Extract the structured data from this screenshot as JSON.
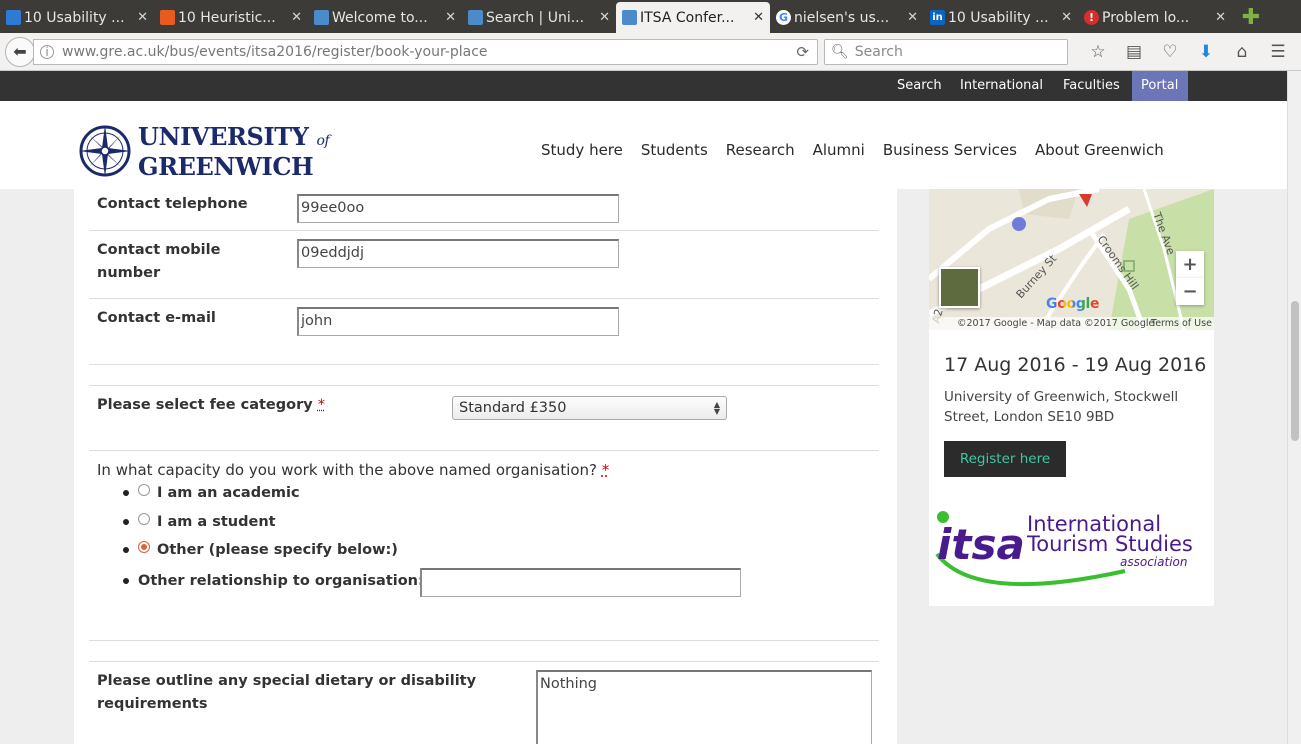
{
  "browser": {
    "tabs": [
      {
        "title": "10 Usability ...",
        "fav_color": "#2f7bd4",
        "active": false
      },
      {
        "title": "10 Heuristic...",
        "fav_color": "#e85b1c",
        "active": false
      },
      {
        "title": "Welcome to...",
        "fav_color": "#4b8bc9",
        "active": false
      },
      {
        "title": "Search | Uni...",
        "fav_color": "#4b8bc9",
        "active": false
      },
      {
        "title": "ITSA Confer...",
        "fav_color": "#4b8bc9",
        "active": true
      },
      {
        "title": "nielsen's us...",
        "fav_color": "#4285f4",
        "active": false
      },
      {
        "title": "10 Usability ...",
        "fav_color": "#0a66c2",
        "active": false
      },
      {
        "title": "Problem lo...",
        "fav_color": "#d32f2f",
        "active": false
      }
    ],
    "url_host": "www.gre.ac.uk",
    "url_path": "/bus/events/itsa2016/register/book-your-place",
    "search_placeholder": "Search"
  },
  "utility_nav": [
    "Search",
    "International",
    "Faculties",
    "Portal"
  ],
  "logo": {
    "line1": "UNIVERSITY",
    "of": "of",
    "line2": "GREENWICH"
  },
  "main_nav": [
    "Study here",
    "Students",
    "Research",
    "Alumni",
    "Business Services",
    "About Greenwich"
  ],
  "form": {
    "telephone": {
      "label": "Contact telephone",
      "value": "99ee0oo"
    },
    "mobile": {
      "label_line1": "Contact mobile",
      "label_line2": "number",
      "value": "09eddjdj"
    },
    "email": {
      "label": "Contact e-mail",
      "value": "john"
    },
    "fee": {
      "label": "Please select fee category",
      "required": "*",
      "selected": "Standard £350"
    },
    "capacity": {
      "question": "In what capacity do you work with the above named organisation?",
      "required": "*",
      "options": [
        {
          "label": "I am an academic",
          "checked": false
        },
        {
          "label": "I am a student",
          "checked": false
        },
        {
          "label": "Other (please specify below:)",
          "checked": true
        }
      ],
      "other_label": "Other relationship to organisation:",
      "other_value": ""
    },
    "dietary": {
      "label_line1": "Please outline any special dietary or disability",
      "label_line2": "requirements",
      "value": "Nothing"
    }
  },
  "sidebar": {
    "map": {
      "streets": [
        "Burney St",
        "Crooms Hill",
        "The Ave",
        "A2"
      ],
      "google": "Google",
      "attribution": "©2017 Google - Map data ©2017 Google",
      "terms": "Terms of Use",
      "zoom_in": "+",
      "zoom_out": "−"
    },
    "dates": "17 Aug 2016 - 19 Aug 2016",
    "address": "University of Greenwich, Stockwell Street, London SE10 9BD",
    "register_label": "Register here",
    "itsa_logo": {
      "acronym": "itsa",
      "line1": "International",
      "line2": "Tourism Studies",
      "line3": "association"
    }
  }
}
